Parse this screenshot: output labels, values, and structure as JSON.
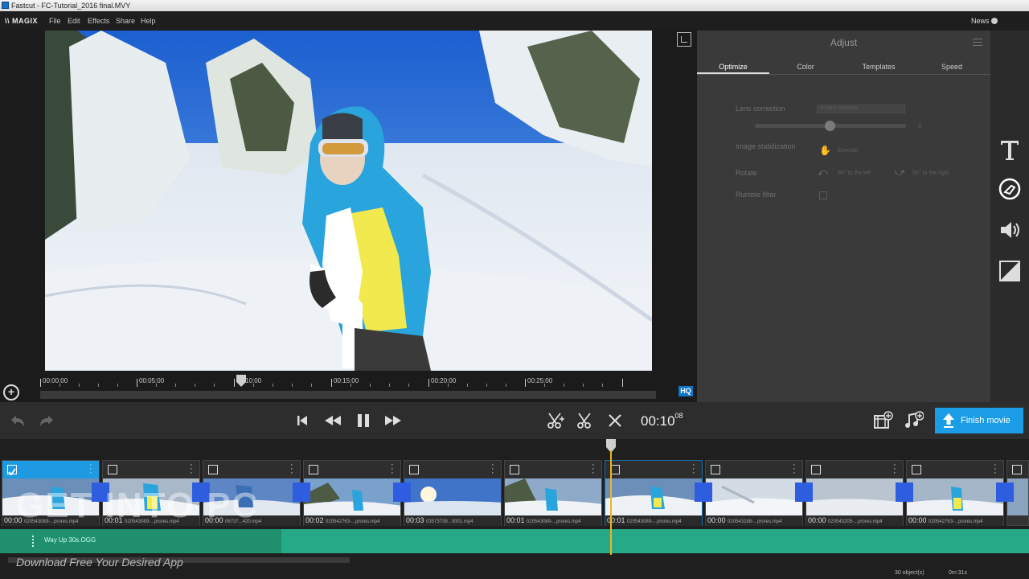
{
  "window": {
    "title": "Fastcut - FC-Tutorial_2016 final.MVY"
  },
  "menubar": {
    "logo": "\\\\ MAGIX",
    "items": [
      "File",
      "Edit",
      "Effects",
      "Share",
      "Help"
    ],
    "news": "News"
  },
  "preview": {
    "ruler_labels": [
      "00:00:00",
      "00:05:00",
      "00:10:00",
      "00:15:00",
      "00:20:00",
      "00:25:00"
    ],
    "quality_badge": "HQ"
  },
  "adjust": {
    "title": "Adjust",
    "tabs": [
      "Optimize",
      "Color",
      "Templates",
      "Speed"
    ],
    "active_tab": "Optimize",
    "lens_correction_label": "Lens correction",
    "lens_select_value": "No lens correction",
    "lens_value": "0",
    "stabilization_label": "Image stabilization",
    "execute_label": "Execute",
    "rotate_label": "Rotate",
    "rotate_left": "90° to the left",
    "rotate_right": "90° to the right",
    "rumble_label": "Rumble filter"
  },
  "transport": {
    "timecode_main": "00:10",
    "timecode_frames": "08",
    "finish_label": "Finish movie"
  },
  "timeline": {
    "clips": [
      {
        "time": "00:00",
        "frames": "",
        "file": "020543089-...prores.mp4"
      },
      {
        "time": "00:01",
        "frames": "",
        "file": "020543089-...prores.mp4"
      },
      {
        "time": "00:00",
        "frames": "",
        "file": "06737...420.mp4"
      },
      {
        "time": "00:02",
        "frames": "15",
        "file": "020542763-...prores.mp4"
      },
      {
        "time": "00:03",
        "frames": "06",
        "file": "03573739...0001.mp4"
      },
      {
        "time": "00:01",
        "frames": "13",
        "file": "020543089-...prores.mp4"
      },
      {
        "time": "00:01",
        "frames": "13",
        "file": "020543089-...prores.mp4"
      },
      {
        "time": "00:00",
        "frames": "18",
        "file": "020543188-...prores.mp4"
      },
      {
        "time": "00:00",
        "frames": "17",
        "file": "020543205-...prores.mp4"
      },
      {
        "time": "00:00",
        "frames": "22",
        "file": "020542763-...prores.mp4"
      }
    ],
    "audio_label": "Way Up 30s.OGG"
  },
  "watermark": {
    "big": "GET INTO PC",
    "sub": "Download Free Your Desired App"
  },
  "status": {
    "objects": "30 object(s)",
    "duration": "0m:31s"
  },
  "colors": {
    "accent": "#1a9de6",
    "audio": "#25a986",
    "playhead": "#f0b423",
    "transition": "#2f5de0"
  }
}
